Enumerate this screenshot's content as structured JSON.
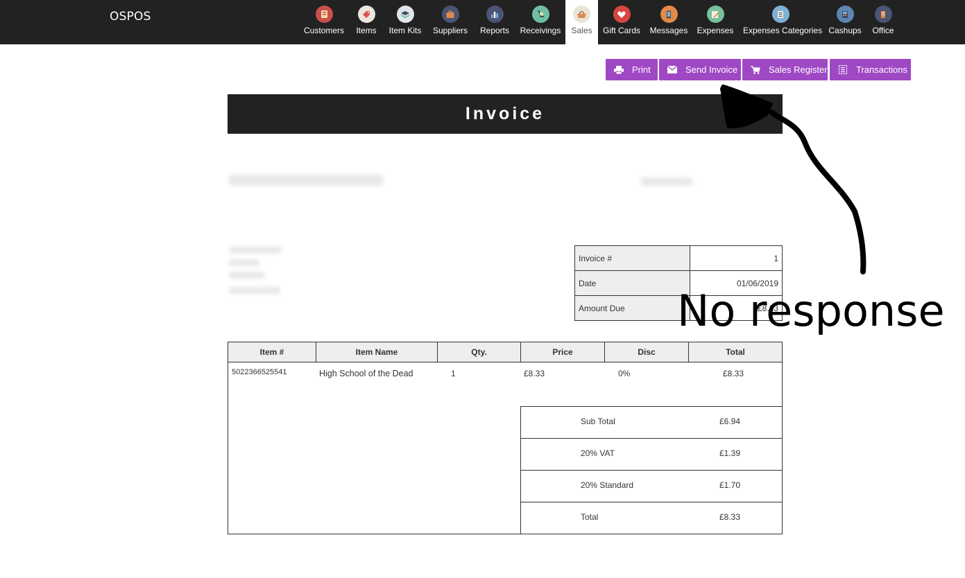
{
  "app": {
    "brand": "OSPOS"
  },
  "nav": {
    "items": [
      {
        "label": "Customers",
        "icon": "customers-icon",
        "color": "#c9504b",
        "glyph": "👥"
      },
      {
        "label": "Items",
        "icon": "items-tag-icon",
        "color": "#e8e1d8",
        "glyph": "🏷"
      },
      {
        "label": "Item Kits",
        "icon": "item-kits-icon",
        "color": "#dfe5ea",
        "glyph": "▤"
      },
      {
        "label": "Suppliers",
        "icon": "suppliers-briefcase-icon",
        "color": "#4a5575",
        "glyph": "💼"
      },
      {
        "label": "Reports",
        "icon": "reports-chart-icon",
        "color": "#4a5575",
        "glyph": "▮"
      },
      {
        "label": "Receivings",
        "icon": "receivings-icon",
        "color": "#6fbfa6",
        "glyph": "✎"
      },
      {
        "label": "Sales",
        "icon": "sales-basket-icon",
        "color": "#e9e4d6",
        "glyph": "🧺"
      },
      {
        "label": "Gift Cards",
        "icon": "gift-cards-heart-icon",
        "color": "#d9453f",
        "glyph": "♥"
      },
      {
        "label": "Messages",
        "icon": "messages-phone-icon",
        "color": "#e2894a",
        "glyph": "▯"
      },
      {
        "label": "Expenses",
        "icon": "expenses-icon",
        "color": "#78c09a",
        "glyph": "✎"
      },
      {
        "label": "Expenses Categories",
        "icon": "expenses-categories-icon",
        "color": "#7fb1d6",
        "glyph": "☰"
      },
      {
        "label": "Cashups",
        "icon": "cashups-icon",
        "color": "#5d86b0",
        "glyph": "▦"
      },
      {
        "label": "Office",
        "icon": "office-icon",
        "color": "#4a5575",
        "glyph": "▥"
      }
    ],
    "active": "Sales"
  },
  "actions": {
    "print": "Print",
    "send_invoice": "Send Invoice",
    "sales_register": "Sales Register",
    "transactions": "Transactions",
    "color": "#9f48c4"
  },
  "invoice": {
    "title": "Invoice",
    "meta": {
      "invoice_no_label": "Invoice #",
      "invoice_no": "1",
      "date_label": "Date",
      "date": "01/06/2019",
      "amount_due_label": "Amount Due",
      "amount_due": "£8.33"
    },
    "columns": [
      "Item #",
      "Item Name",
      "Qty.",
      "Price",
      "Disc",
      "Total"
    ],
    "rows": [
      {
        "item_no": "5022366525541",
        "name": "High School of the Dead",
        "qty": "1",
        "price": "£8.33",
        "disc": "0%",
        "total": "£8.33"
      }
    ],
    "totals": [
      {
        "label": "Sub Total",
        "value": "£6.94"
      },
      {
        "label": "20% VAT",
        "value": "£1.39"
      },
      {
        "label": "20% Standard",
        "value": "£1.70"
      },
      {
        "label": "Total",
        "value": "£8.33"
      }
    ]
  },
  "annotation": {
    "text": "No response"
  }
}
